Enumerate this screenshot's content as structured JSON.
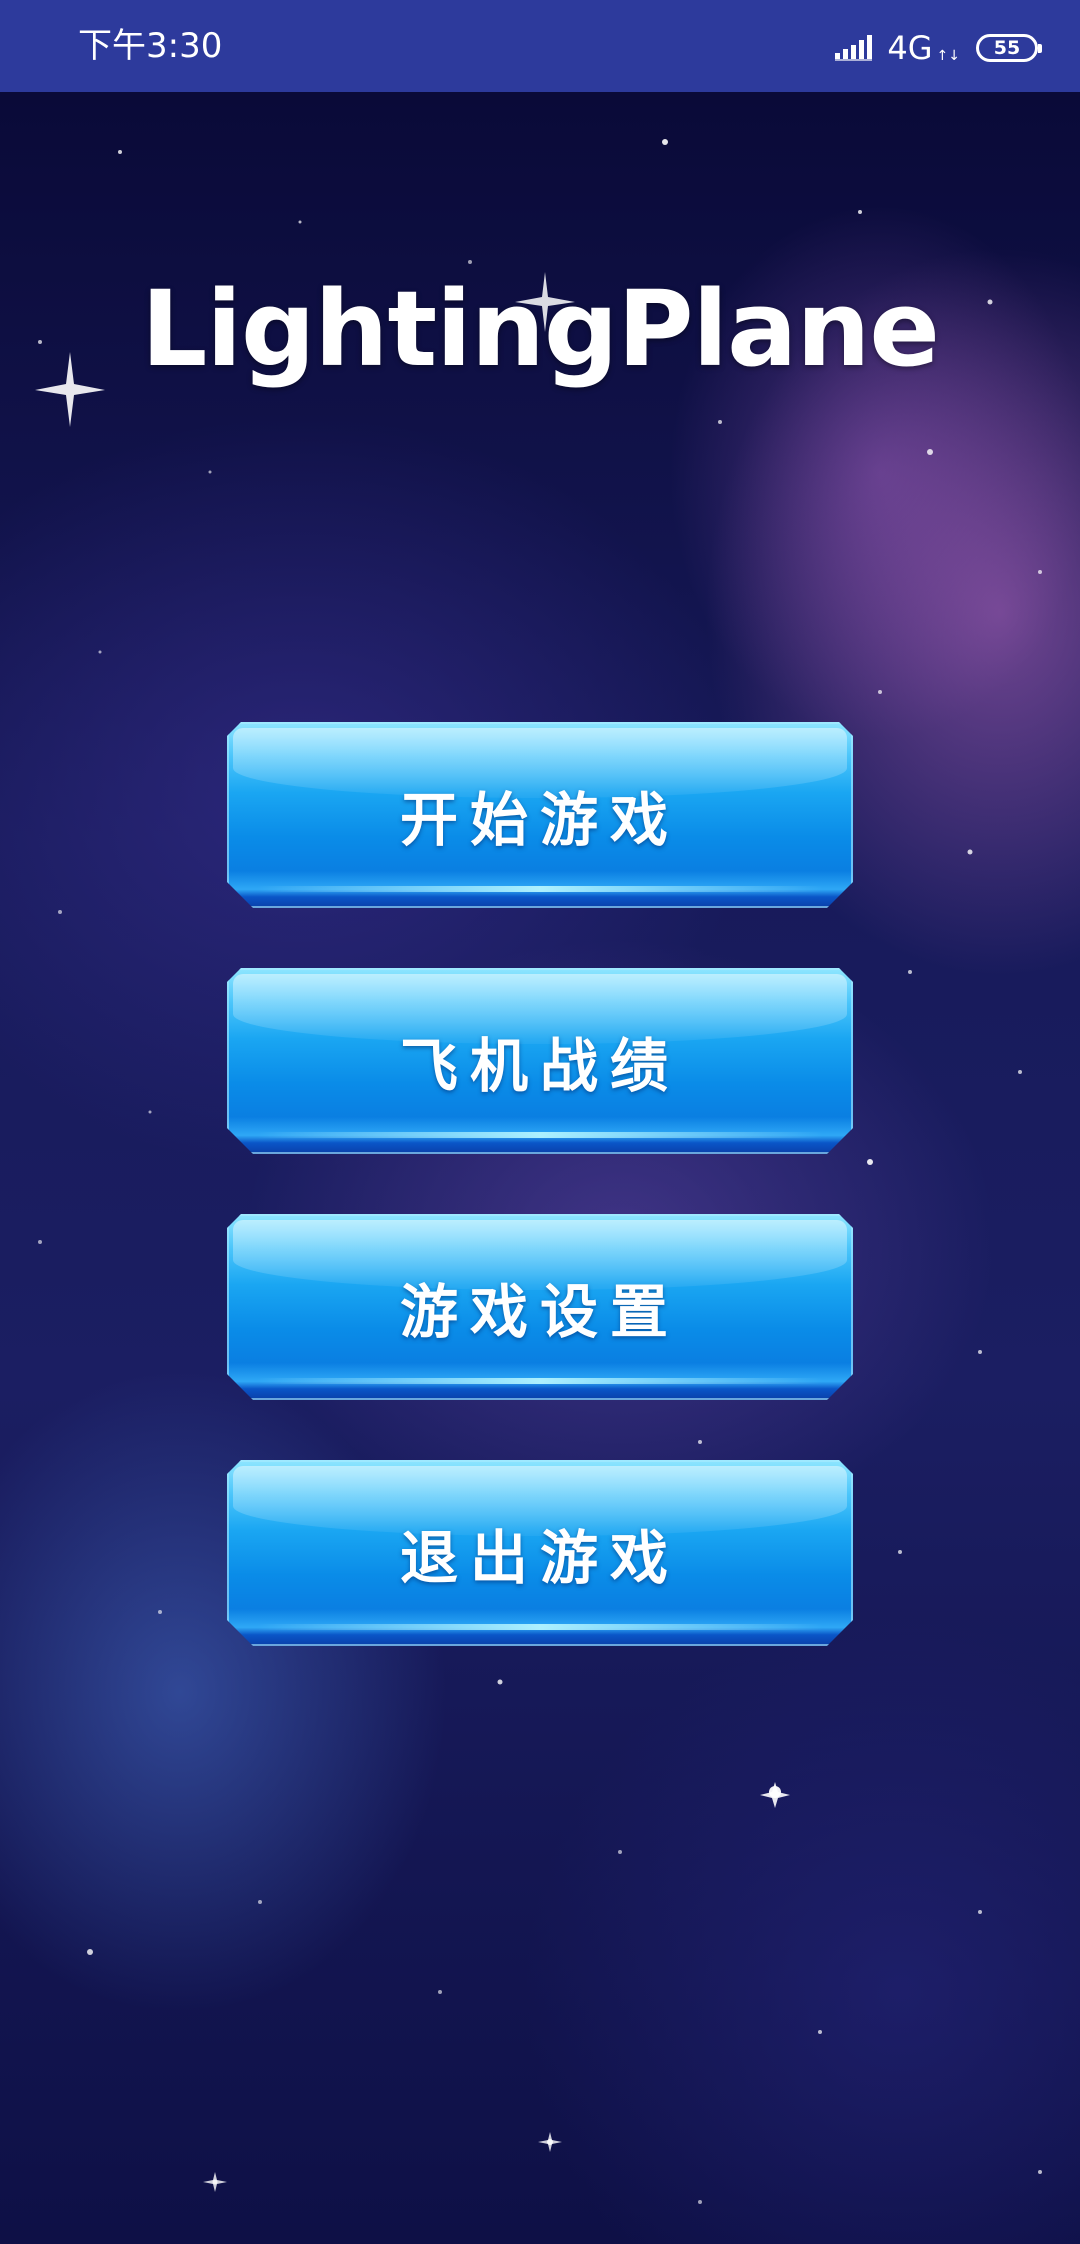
{
  "status_bar": {
    "time": "下午3:30",
    "network": "4G",
    "network_sub": "↑↓",
    "battery": "55",
    "icons": [
      "signal-icon",
      "battery-icon"
    ]
  },
  "app": {
    "title": "LightingPlane"
  },
  "menu": {
    "items": [
      {
        "label": "开始游戏"
      },
      {
        "label": "飞机战绩"
      },
      {
        "label": "游戏设置"
      },
      {
        "label": "退出游戏"
      }
    ]
  },
  "colors": {
    "status_bar": "#2d3a9c",
    "button_primary": "#0a8ce8",
    "button_highlight": "#8fe6ff",
    "background": "#171a5a"
  }
}
